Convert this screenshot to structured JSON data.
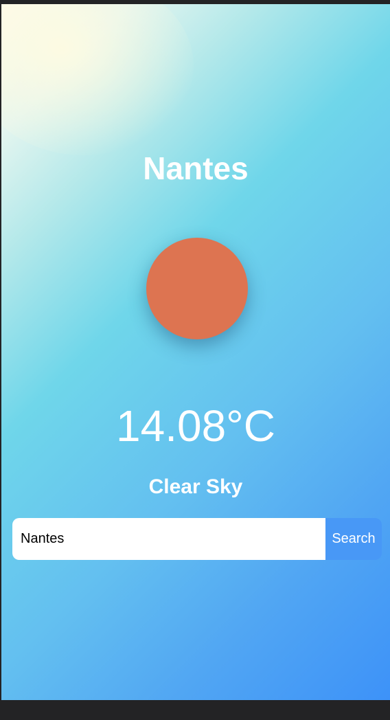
{
  "weather": {
    "city": "Nantes",
    "temperature": "14.08°C",
    "description": "Clear Sky",
    "icon": "sun-icon",
    "icon_color": "#dd7451"
  },
  "search": {
    "value": "Nantes",
    "button_label": "Search"
  },
  "colors": {
    "gradient_start": "#fffbe9",
    "gradient_mid": "#6fd6ea",
    "gradient_end": "#3d92f8",
    "button": "#4898f6"
  }
}
